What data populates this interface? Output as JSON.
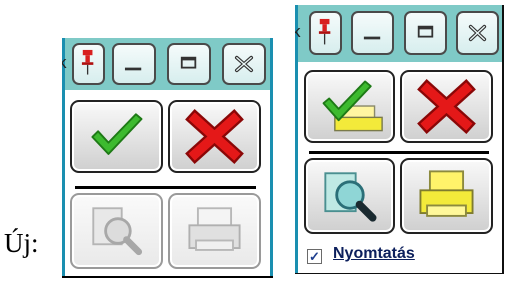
{
  "caption": {
    "label": "Új:"
  },
  "panels": {
    "left": {
      "window_controls": {
        "tab_fragment": "k",
        "pin_icon": "pin-icon",
        "minimize_icon": "minimize-icon",
        "maximize_icon": "maximize-icon",
        "close_icon": "close-icon"
      },
      "actions": [
        {
          "icon": "checkmark-icon",
          "state": "enabled"
        },
        {
          "icon": "red-x-icon",
          "state": "enabled"
        },
        {
          "icon": "print-preview-icon",
          "state": "disabled"
        },
        {
          "icon": "printer-icon",
          "state": "disabled"
        }
      ]
    },
    "right": {
      "window_controls": {
        "tab_fragment": "k",
        "pin_icon": "pin-icon",
        "minimize_icon": "minimize-icon",
        "maximize_icon": "maximize-icon",
        "close_icon": "close-icon"
      },
      "actions": [
        {
          "icon": "check-print-icon",
          "state": "enabled"
        },
        {
          "icon": "red-x-icon",
          "state": "enabled"
        },
        {
          "icon": "print-preview-icon",
          "state": "enabled"
        },
        {
          "icon": "printer-icon",
          "state": "enabled"
        }
      ],
      "print_option": {
        "label": "Nyomtatás",
        "checked": true
      }
    }
  },
  "colors": {
    "titlebar": "#7fcac7",
    "accent_border": "#1a8fb0",
    "check_green": "#37b52d",
    "cross_red": "#d10f0f",
    "printer_yellow": "#f3ea3a",
    "label_blue": "#0c1f5c"
  }
}
